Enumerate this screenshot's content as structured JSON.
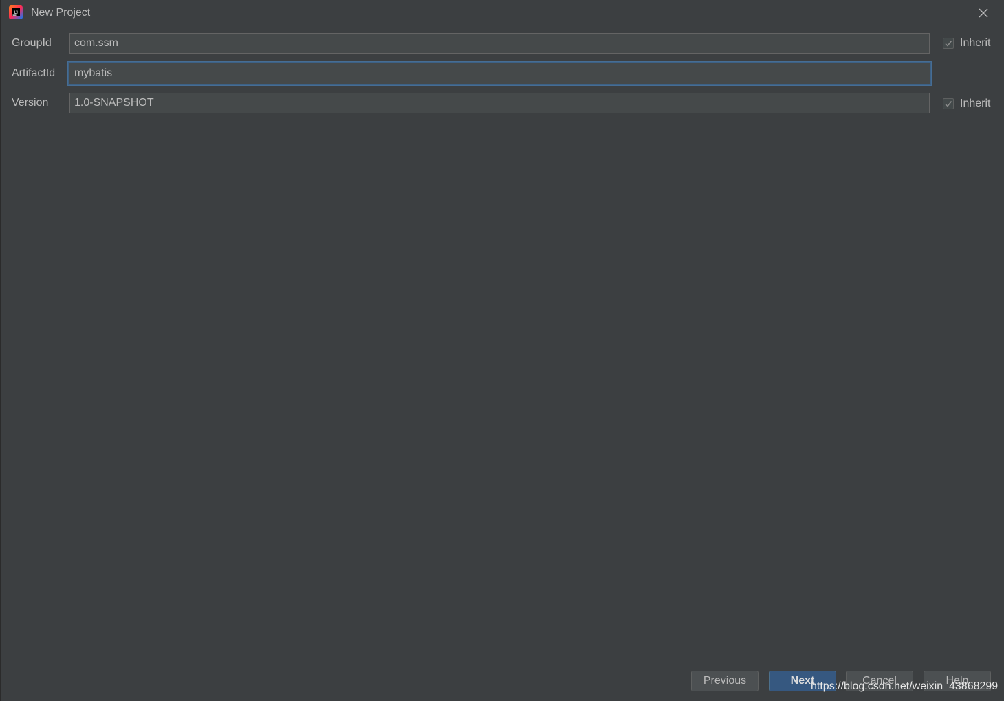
{
  "window": {
    "title": "New Project",
    "logo_text": "IJ"
  },
  "form": {
    "group_id": {
      "label": "GroupId",
      "value": "com.ssm",
      "inherit_label": "Inherit",
      "inherit_checked": true
    },
    "artifact_id": {
      "label": "ArtifactId",
      "value": "mybatis",
      "focused": true
    },
    "version": {
      "label": "Version",
      "value": "1.0-SNAPSHOT",
      "inherit_label": "Inherit",
      "inherit_checked": true
    }
  },
  "buttons": {
    "previous": "Previous",
    "next": "Next",
    "cancel": "Cancel",
    "help": "Help"
  },
  "watermark": "https://blog.csdn.net/weixin_43868299",
  "colors": {
    "background": "#3c3f41",
    "field_background": "#45494a",
    "focus_border": "#3d6185",
    "default_button": "#365880",
    "text": "#bbbbbb"
  }
}
